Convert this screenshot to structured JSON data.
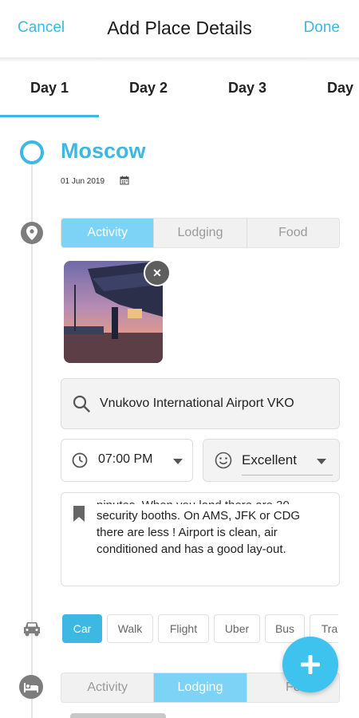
{
  "header": {
    "cancel": "Cancel",
    "title": "Add Place Details",
    "done": "Done"
  },
  "tabs": [
    "Day 1",
    "Day 2",
    "Day 3",
    "Day"
  ],
  "place": {
    "city": "Moscow",
    "date": "01 Jun 2019"
  },
  "category_tabs": [
    "Activity",
    "Lodging",
    "Food"
  ],
  "search": {
    "value": "Vnukovo International Airport VKO"
  },
  "time": {
    "value": "07:00 PM"
  },
  "rating": {
    "value": "Excellent"
  },
  "notes": {
    "text_cut": "ninutes. When you land there are 30",
    "text": "security booths. On AMS, JFK or CDG there are less ! Airport is clean, air conditioned and has a good lay-out."
  },
  "transport": [
    "Car",
    "Walk",
    "Flight",
    "Uber",
    "Bus",
    "Tra"
  ],
  "lodging_tabs": [
    "Activity",
    "Lodging",
    "Fo"
  ],
  "colors": {
    "accent": "#3cb8e2",
    "segment_active": "#7dd3f5",
    "icon_gray": "#7d7d7d"
  }
}
